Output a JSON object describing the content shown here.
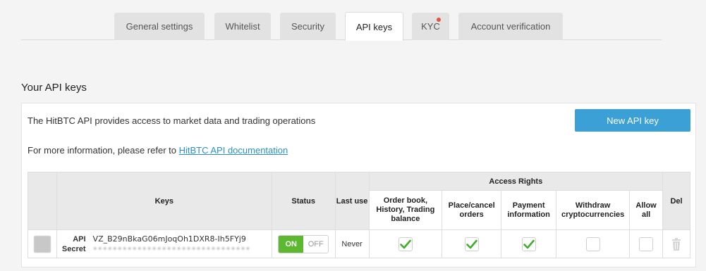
{
  "tabs": [
    {
      "label": "General settings"
    },
    {
      "label": "Whitelist"
    },
    {
      "label": "Security"
    },
    {
      "label": "API keys"
    },
    {
      "label": "KYC"
    },
    {
      "label": "Account verification"
    }
  ],
  "active_tab": "API keys",
  "section_title": "Your API keys",
  "panel": {
    "intro": "The HitBTC API provides access to market data and trading operations",
    "more_prefix": "For more information, please refer to ",
    "more_link": "HitBTC API documentation",
    "new_button": "New API key"
  },
  "table": {
    "headers": {
      "keys": "Keys",
      "status": "Status",
      "last_use": "Last use",
      "access_rights": "Access Rights",
      "del": "Del",
      "rights": [
        "Order book, History, Trading balance",
        "Place/cancel orders",
        "Payment information",
        "Withdraw cryptocurrencies",
        "Allow all"
      ]
    },
    "rows": [
      {
        "api_label": "API",
        "secret_label": "Secret",
        "api_key": "VZ_B29nBkaG06mJoqOh1DXR8-Ih5FYj9",
        "secret": "••••••••••••••••••••••••••••••••",
        "status_on": "ON",
        "status_off": "OFF",
        "last_use": "Never",
        "rights_checked": [
          true,
          true,
          true,
          false,
          false
        ]
      }
    ]
  },
  "colors": {
    "accent": "#3aa0d5",
    "link": "#2a8fc4",
    "toggle_on": "#5cb82e",
    "check": "#3fae29",
    "kyc_dot": "#e5533d"
  }
}
